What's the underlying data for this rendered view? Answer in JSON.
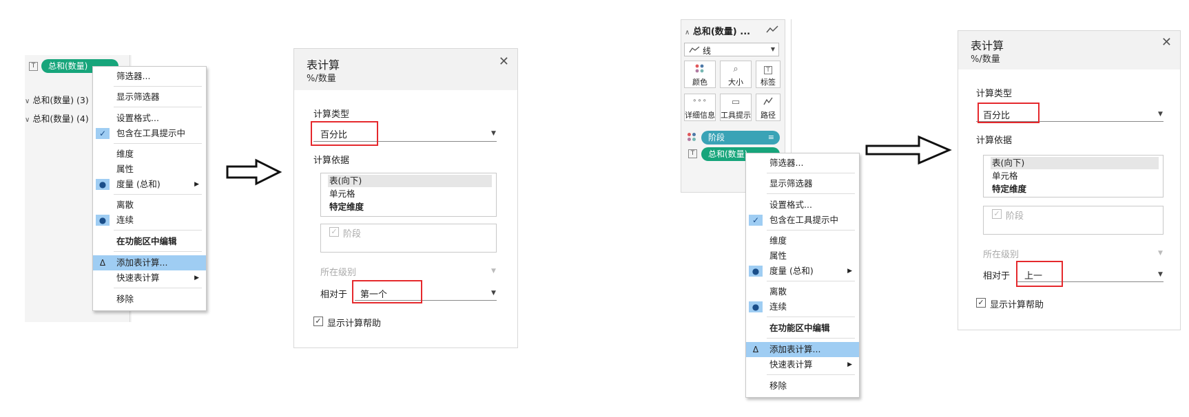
{
  "left_panel": {
    "pill_label": "总和(数量)",
    "tree_items": [
      "总和(数量) (3)",
      "总和(数量) (4)"
    ]
  },
  "context_menu": {
    "items": [
      {
        "label": "筛选器...",
        "mark": ""
      },
      {
        "label": "显示筛选器",
        "mark": ""
      },
      {
        "label": "设置格式...",
        "mark": ""
      },
      {
        "label": "包含在工具提示中",
        "mark": "✓"
      },
      {
        "label": "维度",
        "mark": ""
      },
      {
        "label": "属性",
        "mark": ""
      },
      {
        "label": "度量 (总和)",
        "mark": "●",
        "submenu": true
      },
      {
        "label": "离散",
        "mark": ""
      },
      {
        "label": "连续",
        "mark": "●"
      },
      {
        "label": "在功能区中编辑",
        "mark": "",
        "bold": true
      },
      {
        "label": "添加表计算...",
        "mark": "Δ",
        "highlighted": true
      },
      {
        "label": "快速表计算",
        "mark": "",
        "submenu": true
      },
      {
        "label": "移除",
        "mark": ""
      }
    ]
  },
  "dialog1": {
    "title": "表计算",
    "subtitle": "%/数量",
    "close": "✕",
    "calc_type_label": "计算类型",
    "calc_type_value": "百分比",
    "compute_using_label": "计算依据",
    "compute_options": [
      "表(向下)",
      "单元格",
      "特定维度"
    ],
    "dimension_item": "阶段",
    "level_label": "所在级别",
    "relative_label": "相对于",
    "relative_value": "第一个",
    "show_help": "显示计算帮助"
  },
  "marks_card": {
    "header": "总和(数量) ...",
    "mark_type": "线",
    "cells": [
      {
        "label": "颜色",
        "icon": "color-dots-icon"
      },
      {
        "label": "大小",
        "icon": "size-icon"
      },
      {
        "label": "标签",
        "icon": "label-icon"
      },
      {
        "label": "详细信息",
        "icon": "detail-icon"
      },
      {
        "label": "工具提示",
        "icon": "tooltip-icon"
      },
      {
        "label": "路径",
        "icon": "path-icon"
      }
    ],
    "pill1": "阶段",
    "pill2": "总和(数量)"
  },
  "dialog2": {
    "title": "表计算",
    "subtitle": "%/数量",
    "close": "✕",
    "calc_type_label": "计算类型",
    "calc_type_value": "百分比",
    "compute_using_label": "计算依据",
    "compute_options": [
      "表(向下)",
      "单元格",
      "特定维度"
    ],
    "dimension_item": "阶段",
    "level_label": "所在级别",
    "relative_label": "相对于",
    "relative_value": "上一",
    "show_help": "显示计算帮助"
  },
  "colors": {
    "pill_green": "#17a57b",
    "pill_teal": "#3aa3b6",
    "menu_highlight": "#9fcdf3",
    "annotation_red": "#e5282c"
  }
}
